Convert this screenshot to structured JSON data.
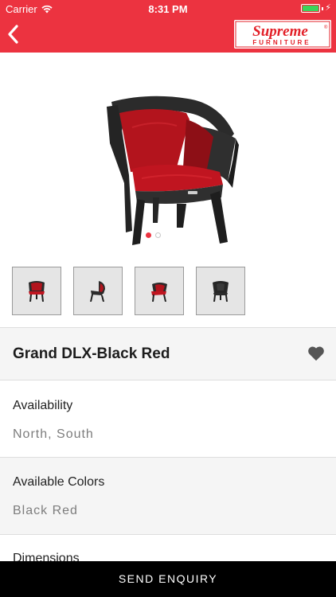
{
  "status_bar": {
    "carrier": "Carrier",
    "time": "8:31 PM",
    "battery_color": "#3cd35a"
  },
  "header": {
    "background_color": "#ec3340",
    "back_icon": "chevron-left-icon",
    "logo": {
      "brand": "Supreme",
      "sub": "FURNITURE",
      "mark": "®"
    }
  },
  "gallery": {
    "image": "chair-black-red",
    "dots": [
      "active",
      "inactive"
    ],
    "thumbnails": [
      "front-view",
      "side-view",
      "three-quarter-view",
      "back-view"
    ]
  },
  "product": {
    "title": "Grand DLX-Black Red",
    "favorite_icon": "heart-icon"
  },
  "details": {
    "availability": {
      "label": "Availability",
      "value": "North, South"
    },
    "colors": {
      "label": "Available Colors",
      "value": "Black Red"
    },
    "dimensions": {
      "label": "Dimensions"
    }
  },
  "footer": {
    "button_label": "SEND ENQUIRY"
  }
}
